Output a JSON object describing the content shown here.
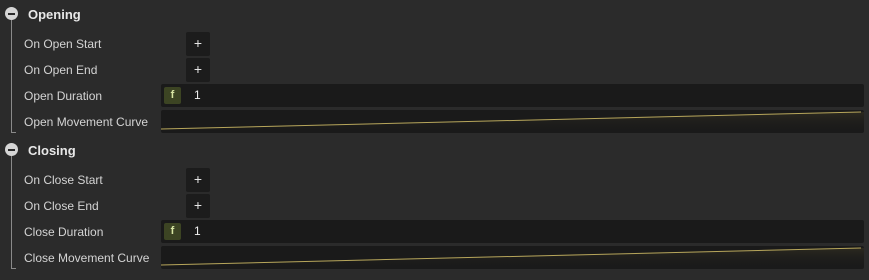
{
  "sections": [
    {
      "title": "Opening",
      "start_label": "On Open Start",
      "end_label": "On Open End",
      "duration_label": "Open Duration",
      "duration_type": "f",
      "duration_value": "1",
      "curve_label": "Open Movement Curve",
      "add_symbol": "+"
    },
    {
      "title": "Closing",
      "start_label": "On Close Start",
      "end_label": "On Close End",
      "duration_label": "Close Duration",
      "duration_type": "f",
      "duration_value": "1",
      "curve_label": "Close Movement Curve",
      "add_symbol": "+"
    }
  ],
  "colors": {
    "background": "#2b2b2b",
    "field": "#1a1a1a",
    "curve": "#b7a65b",
    "float_badge": "#3c4423"
  }
}
